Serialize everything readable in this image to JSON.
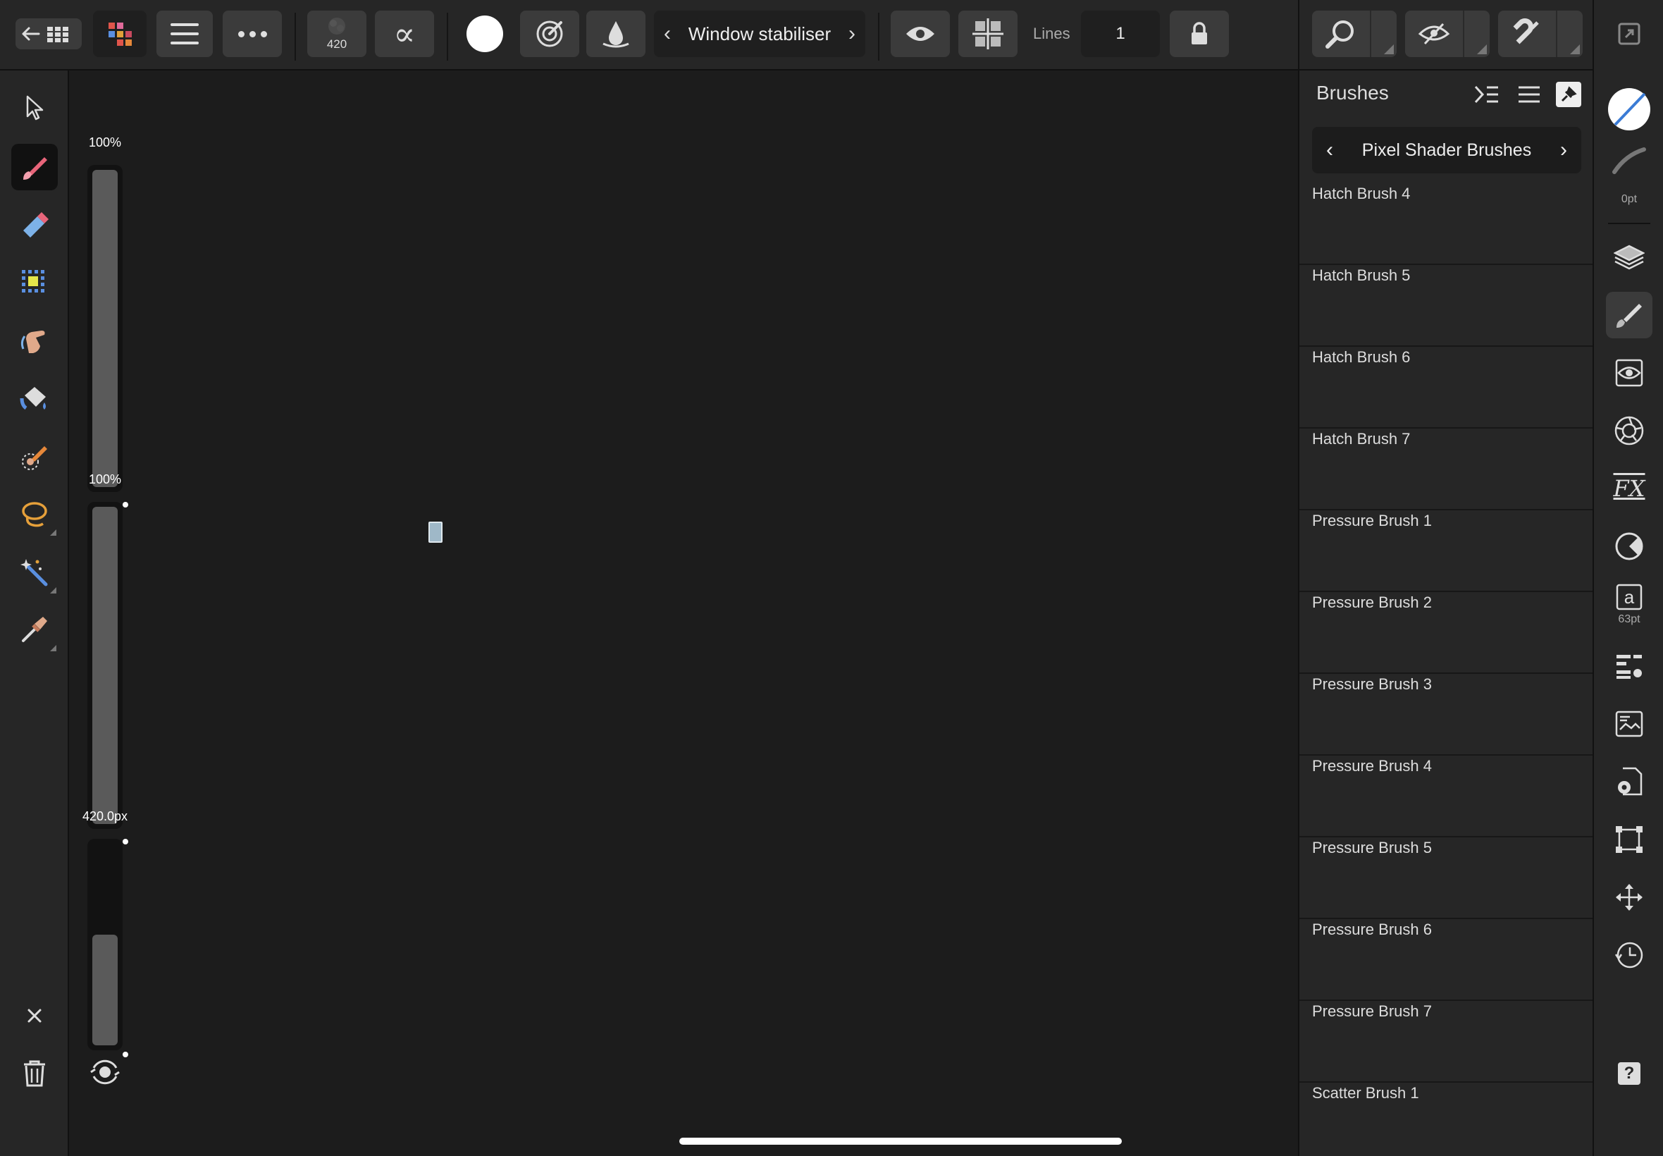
{
  "toolbar": {
    "brush_size_badge": "420",
    "stabiliser_label": "Window stabiliser",
    "lines_label": "Lines",
    "lines_value": "1"
  },
  "sliders": {
    "opacity_label": "100%",
    "flow_label": "100%",
    "width_label": "420.0px",
    "opacity_value": 1.0,
    "flow_value": 1.0,
    "width_value": 0.55
  },
  "panel": {
    "title": "Brushes",
    "category": "Pixel Shader Brushes",
    "brushes": [
      "Hatch Brush 4",
      "Hatch Brush 5",
      "Hatch Brush 6",
      "Hatch Brush 7",
      "Pressure Brush 1",
      "Pressure Brush 2",
      "Pressure Brush 3",
      "Pressure Brush 4",
      "Pressure Brush 5",
      "Pressure Brush 6",
      "Pressure Brush 7",
      "Scatter Brush 1"
    ]
  },
  "rightbar": {
    "stroke_width_caption": "0pt",
    "text_size_caption": "63pt",
    "text_glyph": "a",
    "fx_glyph": "FX",
    "help_glyph": "?"
  },
  "colors": {
    "background": "#1c1c1c",
    "panel": "#262626",
    "button": "#3b3b3b",
    "active_tool_brush": "#e8657a",
    "accent_blue": "#3a7bd5"
  }
}
